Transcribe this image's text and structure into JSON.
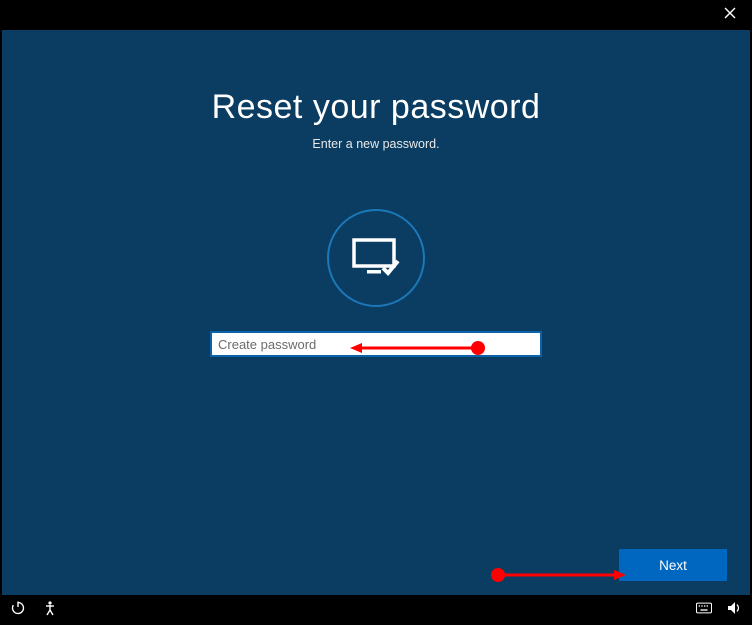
{
  "heading": "Reset your password",
  "subheading": "Enter a new password.",
  "password_field": {
    "placeholder": "Create password",
    "value": ""
  },
  "next_button_label": "Next",
  "colors": {
    "page_bg": "#0a3d61",
    "accent_blue": "#0067c0",
    "circle_border": "#1c78b8"
  }
}
